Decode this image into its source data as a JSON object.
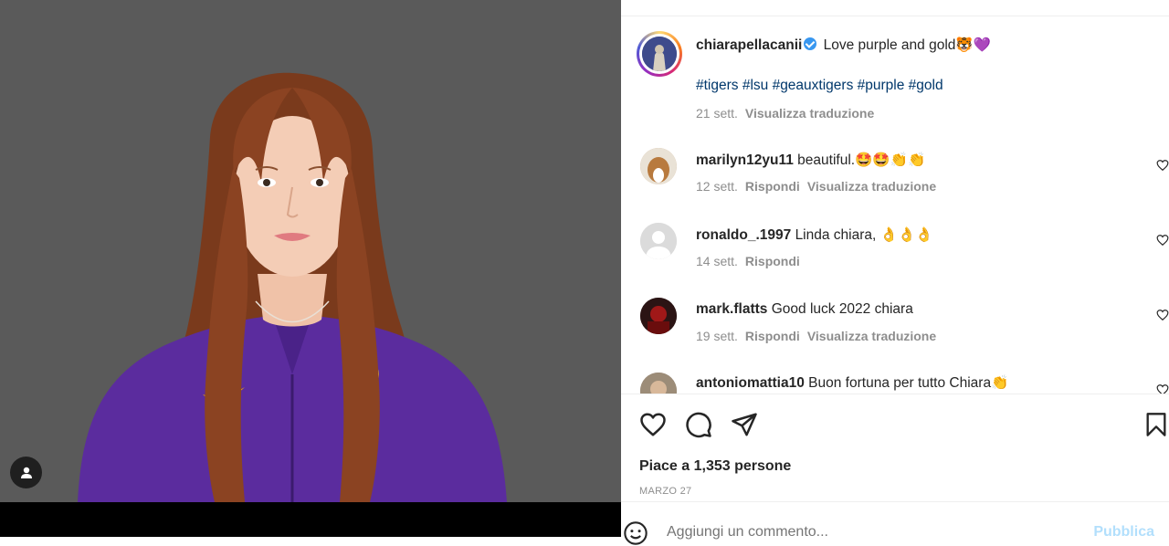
{
  "post": {
    "author": "chiarapellacanii",
    "caption": "Love purple and gold",
    "caption_emoji": "🐯💜",
    "hashtags": "#tigers #lsu #geauxtigers #purple #gold",
    "time": "21 sett.",
    "translate": "Visualizza traduzione"
  },
  "comments": [
    {
      "user": "marilyn12yu11",
      "text": "beautiful.",
      "emoji": "🤩🤩👏👏",
      "time": "12 sett.",
      "reply": "Rispondi",
      "translate": "Visualizza traduzione"
    },
    {
      "user": "ronaldo_.1997",
      "text": "Linda chiara,",
      "emoji": "👌👌👌",
      "time": "14 sett.",
      "reply": "Rispondi"
    },
    {
      "user": "mark.flatts",
      "text": "Good luck 2022 chiara",
      "time": "19 sett.",
      "reply": "Rispondi",
      "translate": "Visualizza traduzione"
    },
    {
      "user": "antoniomattia10",
      "text": "Buon fortuna per tutto Chiara",
      "emoji": "👏"
    }
  ],
  "likes": "Piace a 1,353 persone",
  "date": "MARZO 27",
  "comment_box": {
    "placeholder": "Aggiungi un commento...",
    "publish": "Pubblica"
  },
  "colors": {
    "link": "#00376b",
    "verified": "#3897f0",
    "publish_disabled": "#b2dffc",
    "muted": "#8e8e8e"
  },
  "icons": [
    "user-tag-icon",
    "verified-badge-icon",
    "heart-icon",
    "comment-icon",
    "share-icon",
    "bookmark-icon",
    "emoji-smile-icon"
  ]
}
